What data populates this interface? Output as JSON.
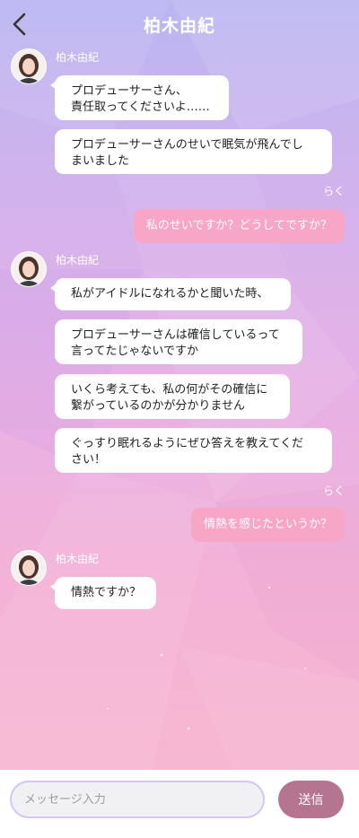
{
  "header": {
    "title": "柏木由紀"
  },
  "chat": {
    "character_name": "柏木由紀",
    "user_name": "らく",
    "groups": [
      {
        "messages": [
          "プロデューサーさん、\n責任取ってくださいよ……",
          "プロデューサーさんのせいで眠気が飛んでし\nまいました"
        ]
      },
      {
        "user_message": "私のせいですか？どうしてですか？"
      },
      {
        "messages": [
          "私がアイドルになれるかと聞いた時、",
          "プロデューサーさんは確信しているって\n言ってたじゃないですか",
          "いくら考えても、私の何がその確信に\n繋がっているのかが分かりません",
          "ぐっすり眠れるようにぜひ答えを教えてくだ\nさい！"
        ]
      },
      {
        "user_message": "情熱を感じたというか？"
      },
      {
        "messages": [
          "情熱ですか？"
        ]
      }
    ]
  },
  "input": {
    "placeholder": "メッセージ入力",
    "send_label": "送信"
  },
  "colors": {
    "user_bubble": "#f7a6c6",
    "send_button": "#b5748f"
  }
}
